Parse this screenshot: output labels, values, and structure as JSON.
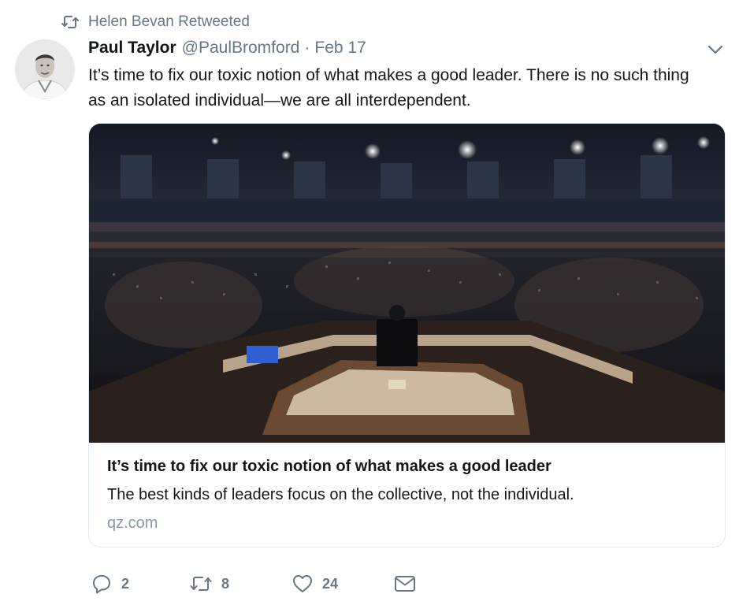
{
  "retweet_context": {
    "text": "Helen Bevan Retweeted",
    "icon": "retweet-icon"
  },
  "author": {
    "name": "Paul Taylor",
    "handle": "@PaulBromford",
    "separator": "·",
    "date": "Feb 17"
  },
  "tweet": {
    "text": "It’s time to fix our toxic notion of what makes a good leader. There is no such thing as an isolated individual—we are all interdependent."
  },
  "card": {
    "title": "It’s time to fix our toxic notion of what makes a good leader",
    "description": "The best kinds of leaders focus on the collective, not the individual.",
    "domain": "qz.com"
  },
  "actions": {
    "reply_count": "2",
    "retweet_count": "8",
    "like_count": "24"
  },
  "colors": {
    "secondary_text": "#657786",
    "border": "#e1e8ed",
    "domain": "#8899a6",
    "primary_text": "#14171a"
  }
}
